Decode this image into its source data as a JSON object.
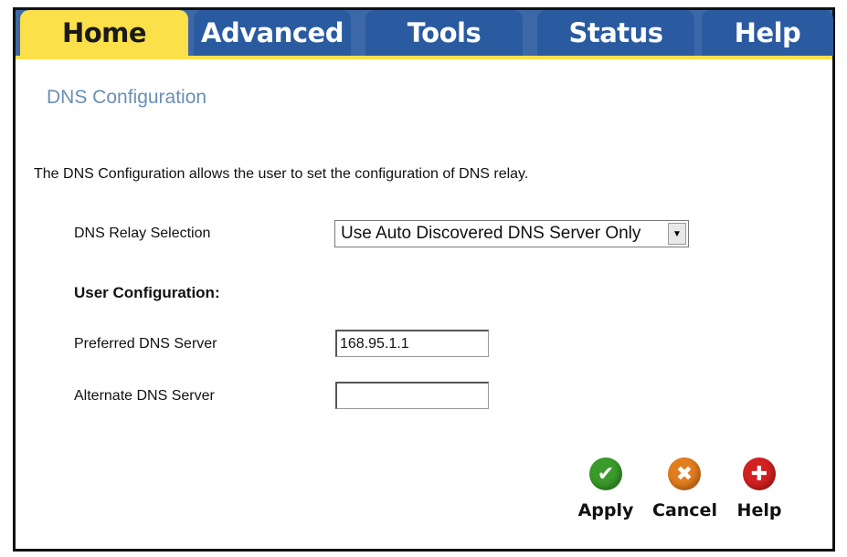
{
  "tabs": [
    "Home",
    "Advanced",
    "Tools",
    "Status",
    "Help"
  ],
  "page": {
    "title": "DNS Configuration",
    "description": "The DNS Configuration allows the user to set the configuration of DNS relay."
  },
  "form": {
    "relay_label": "DNS Relay Selection",
    "relay_value": "Use Auto Discovered DNS Server Only",
    "user_config_label": "User Configuration:",
    "preferred_label": "Preferred DNS Server",
    "preferred_value": "168.95.1.1",
    "alternate_label": "Alternate DNS Server",
    "alternate_value": ""
  },
  "buttons": {
    "apply": "Apply",
    "cancel": "Cancel",
    "help": "Help"
  },
  "colors": {
    "tab_active": "#fbe04a",
    "tab_bar": "#2a5aa0",
    "title": "#6a8fb5",
    "apply_icon": "#3a9a2a",
    "cancel_icon": "#e27d1e",
    "help_icon": "#d32020"
  }
}
